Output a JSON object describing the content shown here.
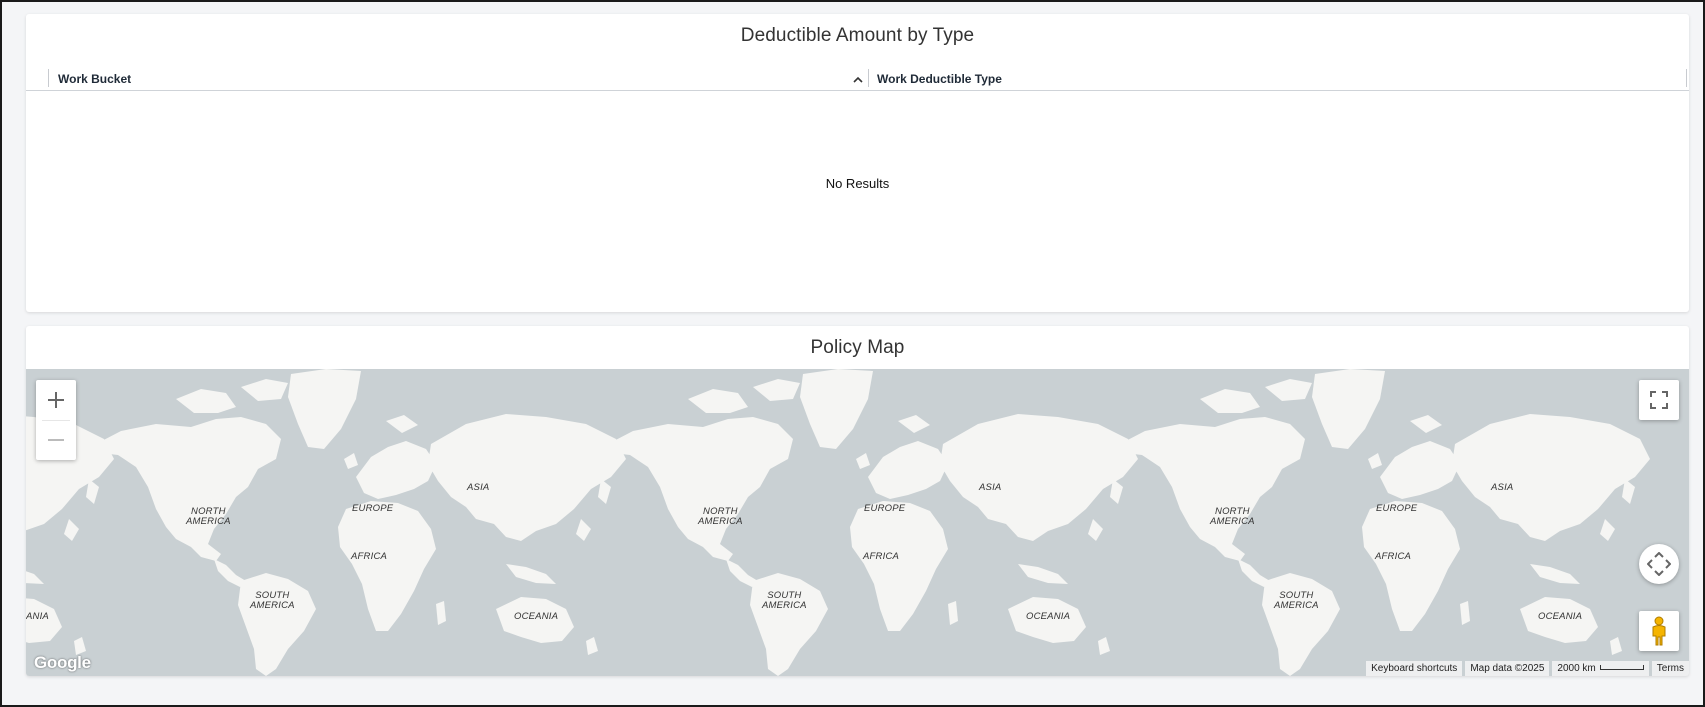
{
  "table_card": {
    "title": "Deductible Amount by Type",
    "columns": [
      "Work Bucket",
      "Work Deductible Type"
    ],
    "sort_column": "Work Bucket",
    "sort_direction": "ascending",
    "empty_message": "No Results"
  },
  "map_card": {
    "title": "Policy Map",
    "continent_labels": {
      "north_america": "NORTH\nAMERICA",
      "south_america": "SOUTH\nAMERICA",
      "europe": "EUROPE",
      "asia": "ASIA",
      "africa": "AFRICA",
      "oceania": "OCEANIA",
      "antarctica_fragment": "ANIA"
    },
    "controls": {
      "zoom_in": "+",
      "zoom_out": "−",
      "fullscreen_icon": "fullscreen-icon",
      "pan_icon": "pan-arrows-icon",
      "street_view_icon": "pegman-icon"
    },
    "logo": "Google",
    "attribution": {
      "keyboard_shortcuts": "Keyboard shortcuts",
      "map_data": "Map data ©2025",
      "scale": "2000 km",
      "terms": "Terms"
    },
    "colors": {
      "water": "#c9d0d3",
      "land": "#f5f5f3",
      "pegman": "#f5b400"
    }
  }
}
